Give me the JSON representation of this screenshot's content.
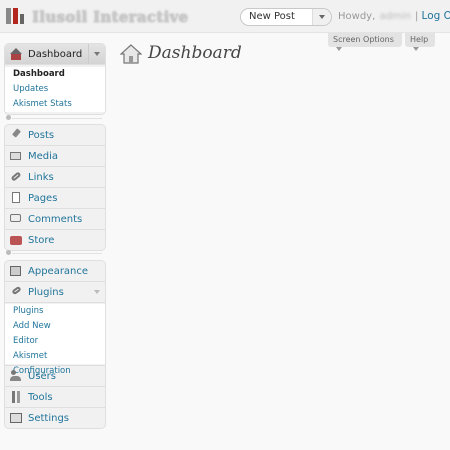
{
  "header": {
    "site_title": "Ilusoil Interactive",
    "favorite_action": "New Post",
    "howdy": "Howdy,",
    "user_name": "admin",
    "separator": "|",
    "logout": "Log Out"
  },
  "meta": {
    "screen_options": "Screen Options",
    "help": "Help"
  },
  "page": {
    "title": "Dashboard"
  },
  "menu": {
    "dashboard": {
      "label": "Dashboard",
      "submenu": [
        "Dashboard",
        "Updates",
        "Akismet Stats"
      ]
    },
    "content": [
      "Posts",
      "Media",
      "Links",
      "Pages",
      "Comments",
      "Store"
    ],
    "appearance": "Appearance",
    "plugins": {
      "label": "Plugins",
      "submenu": [
        "Plugins",
        "Add New",
        "Editor",
        "Akismet Configuration"
      ]
    },
    "users": "Users",
    "tools": "Tools",
    "settings": "Settings"
  },
  "colors": {
    "link": "#21759b",
    "background": "#f9f9f9",
    "menu_bg": "#f1f1f1"
  }
}
